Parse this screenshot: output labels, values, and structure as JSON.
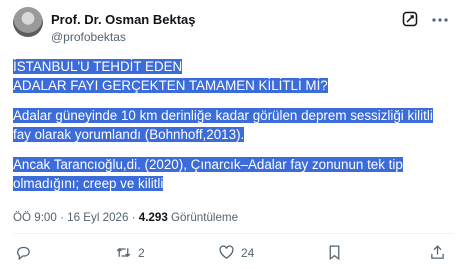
{
  "author": {
    "name": "Prof. Dr. Osman Bektaş",
    "handle": "@profobektas"
  },
  "tweet": {
    "title_lines": [
      "İSTANBUL'U TEHDİT EDEN",
      "ADALAR FAYI GERÇEKTEN TAMAMEN KİLİTLİ Mİ?"
    ],
    "para1_lines": [
      "Adalar güneyinde 10 km derinliğe kadar görülen deprem sessizliği kilitli",
      "fay olarak yorumlandı (Bohnhoff,2013)."
    ],
    "para2_lines": [
      "Ancak Tarancıoğlu,di. (2020), Çınarcık–Adalar fay zonunun tek tip",
      "olmadığını; creep ve kilitli"
    ]
  },
  "meta": {
    "time": "ÖÖ 9:00",
    "separator1": "·",
    "date": "16 Eyl 2026",
    "separator2": "·",
    "views": "4.293",
    "views_label": "Görüntüleme"
  },
  "actions": {
    "reposts": "2",
    "likes": "24"
  },
  "icons": [
    "grok-icon",
    "more-icon",
    "reply-icon",
    "repost-icon",
    "like-icon",
    "bookmark-icon",
    "share-icon"
  ],
  "colors": {
    "highlight": "#3b6cd9",
    "secondary_text": "#536471"
  }
}
